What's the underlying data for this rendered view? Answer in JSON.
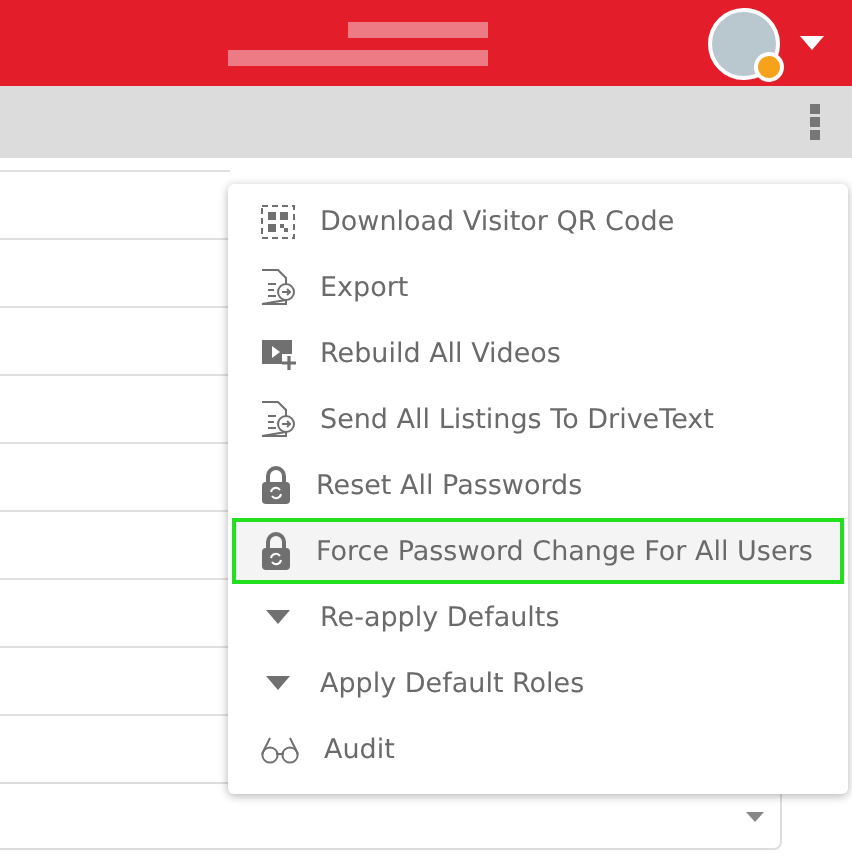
{
  "header": {
    "user": {
      "online": true
    }
  },
  "menu": {
    "items": [
      {
        "kind": "qr",
        "label": "Download Visitor QR Code",
        "selected": false
      },
      {
        "kind": "document",
        "label": "Export",
        "selected": false
      },
      {
        "kind": "video",
        "label": "Rebuild All Videos",
        "selected": false
      },
      {
        "kind": "document",
        "label": "Send All Listings To DriveText",
        "selected": false
      },
      {
        "kind": "lock",
        "label": "Reset All Passwords",
        "selected": false
      },
      {
        "kind": "lock",
        "label": "Force Password Change For All Users",
        "selected": true
      },
      {
        "kind": "caret",
        "label": "Re-apply Defaults",
        "selected": false
      },
      {
        "kind": "caret",
        "label": "Apply Default Roles",
        "selected": false
      },
      {
        "kind": "glasses",
        "label": "Audit",
        "selected": false
      }
    ]
  }
}
